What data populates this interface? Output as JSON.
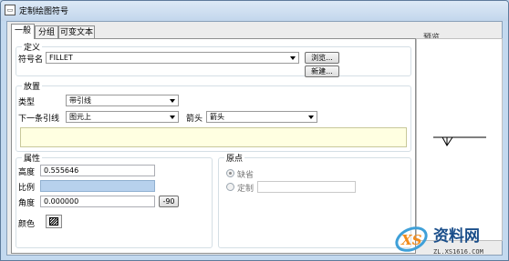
{
  "window": {
    "title": "定制绘图符号",
    "icon": "app-icon"
  },
  "tabs": [
    {
      "label": "一般",
      "active": true
    },
    {
      "label": "分组",
      "active": false
    },
    {
      "label": "可变文本",
      "active": false
    }
  ],
  "definition": {
    "title": "定义",
    "symbol_name_label": "符号名",
    "symbol_name_value": "FILLET",
    "browse_button": "浏览...",
    "new_button": "新建..."
  },
  "placement": {
    "title": "放置",
    "type_label": "类型",
    "type_value": "带引线",
    "next_leader_label": "下一条引线",
    "next_leader_value": "图元上",
    "arrow_label": "箭头",
    "arrow_value": "箭头"
  },
  "attributes": {
    "title": "属性",
    "height_label": "高度",
    "height_value": "0.555646",
    "scale_label": "比例",
    "scale_value": "",
    "angle_label": "角度",
    "angle_value": "0.000000",
    "rotate_button": "-90",
    "color_label": "颜色"
  },
  "origin": {
    "title": "原点",
    "default_label": "缺省",
    "custom_label": "定制",
    "custom_value": "",
    "selected": "default"
  },
  "preview": {
    "title": "预览"
  },
  "watermark": {
    "brand": "资料网",
    "url": "ZL.XS1616.COM",
    "logo_text": "XS"
  },
  "colors": {
    "accent": "#b7d1ed",
    "title_bar": "#c2d6ec",
    "notice": "#ffffe1"
  }
}
